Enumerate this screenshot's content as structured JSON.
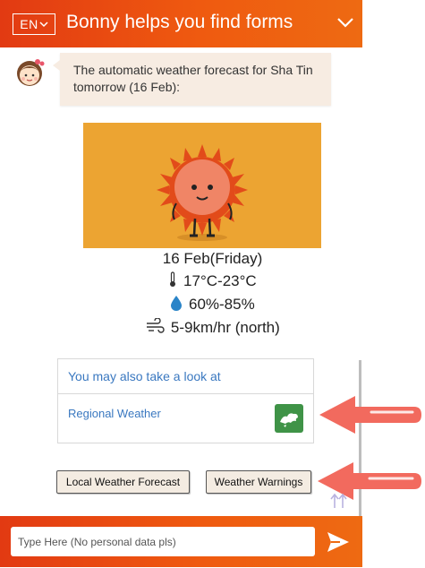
{
  "header": {
    "lang_label": "EN",
    "title": "Bonny helps you find forms"
  },
  "chat": {
    "bot_message": "The automatic weather forecast for Sha Tin tomorrow (16 Feb):",
    "forecast": {
      "date": "16 Feb(Friday)",
      "temperature": "17°C-23°C",
      "humidity": "60%-85%",
      "wind": "5-9km/hr (north)"
    }
  },
  "suggestions": {
    "heading": "You may also take a look at",
    "items": [
      {
        "label": "Regional Weather"
      }
    ]
  },
  "quick_replies": [
    {
      "label": "Local Weather Forecast"
    },
    {
      "label": "Weather Warnings"
    }
  ],
  "footer": {
    "input_placeholder": "Type Here (No personal data pls)"
  },
  "colors": {
    "brand": "#ea4e12",
    "link": "#3a78c0",
    "bubble": "#f7ece2",
    "annotation_arrow": "#f26a5e"
  }
}
